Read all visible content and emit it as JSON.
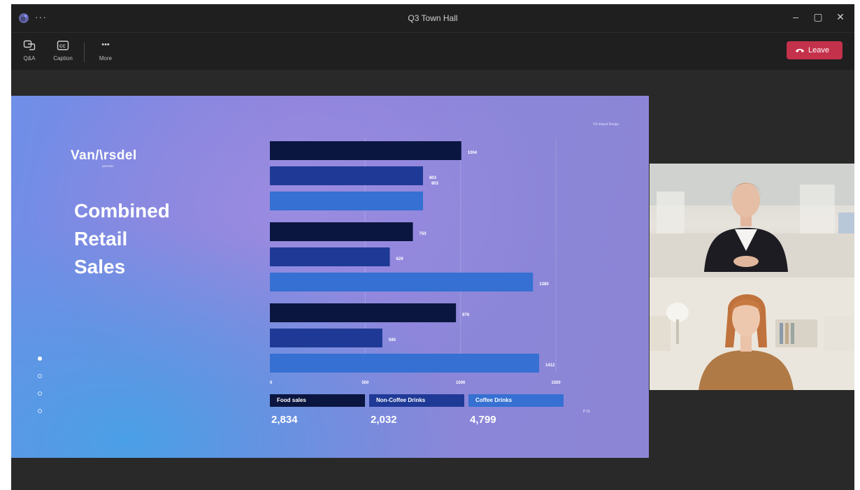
{
  "window": {
    "title": "Q3 Town Hall",
    "menu_glyph": "···"
  },
  "window_controls": {
    "minimize": "–",
    "maximize": "▢",
    "close": "✕"
  },
  "toolbar": {
    "qa_label": "Q&A",
    "caption_label": "Caption",
    "more_label": "More",
    "more_glyph": "•••",
    "leave_label": "Leave",
    "leave_color": "#c4314b"
  },
  "slide": {
    "logo": "Van/\\rsdel",
    "presents": "presents",
    "headline": [
      "Combined",
      "Retail",
      "Sales"
    ],
    "credit": "VA Shared Design",
    "page_number": "P 01",
    "pager_dots": 4,
    "active_dot": 0
  },
  "chart_data": {
    "type": "bar",
    "orientation": "horizontal",
    "groups": 3,
    "series": [
      {
        "name": "Food sales",
        "color": "#0b1640",
        "values": [
          1004,
          750,
          976
        ],
        "total": "2,834"
      },
      {
        "name": "Non-Coffee Drinks",
        "color": "#1f3a96",
        "values": [
          803,
          629,
          590
        ],
        "total": "2,032"
      },
      {
        "name": "Coffee Drinks",
        "color": "#3570d2",
        "values": [
          803,
          1380,
          1412
        ],
        "total": "4,799"
      }
    ],
    "bar_labels": [
      [
        "1004",
        "803",
        "803"
      ],
      [
        "750",
        "629",
        "1380"
      ],
      [
        "976",
        "590",
        "1412"
      ]
    ],
    "x_ticks": [
      0,
      500,
      1000,
      1500
    ],
    "grid": true,
    "legend_placement": "bottom"
  }
}
